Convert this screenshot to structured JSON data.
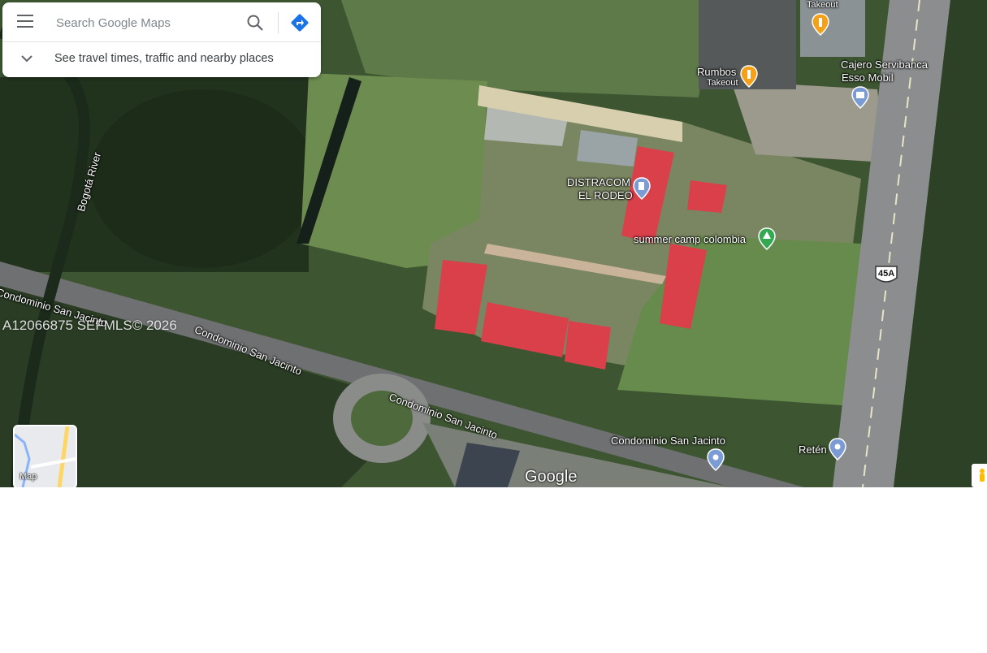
{
  "search": {
    "placeholder": "Search Google Maps",
    "travel_text": "See travel times, traffic and nearby places"
  },
  "icons": {
    "menu": "menu-icon",
    "search": "search-icon",
    "directions": "directions-icon",
    "expand": "chevron-down-icon",
    "pegman": "pegman-icon"
  },
  "places": {
    "takeout_top": "Takeout",
    "rumbos_name": "Rumbos",
    "rumbos_sub": "Takeout",
    "cajero_line1": "Cajero Servibanca",
    "cajero_line2": "Esso Mobil",
    "distracom_line1": "DISTRACOM",
    "distracom_line2": "EL RODEO",
    "summer_camp": "summer camp colombia",
    "condominio_poi": "Condominio San Jacinto",
    "reten": "Retén"
  },
  "roads": {
    "river": "Bogotá River",
    "road_label_1": "Condominio San Jacinto",
    "road_label_2": "Condominio San Jacinto",
    "road_label_3": "Condominio San Jacinto",
    "highway_shield": "45A"
  },
  "watermark": "A12066875  SEFMLS© 2026",
  "layer_toggle": {
    "label": "Map"
  },
  "brand": "Google",
  "colors": {
    "food_pin": "#f4a019",
    "place_pin": "#7b9bd4",
    "park_pin": "#34a853",
    "directions": "#1a73e8",
    "roof_red": "#d9404a"
  }
}
